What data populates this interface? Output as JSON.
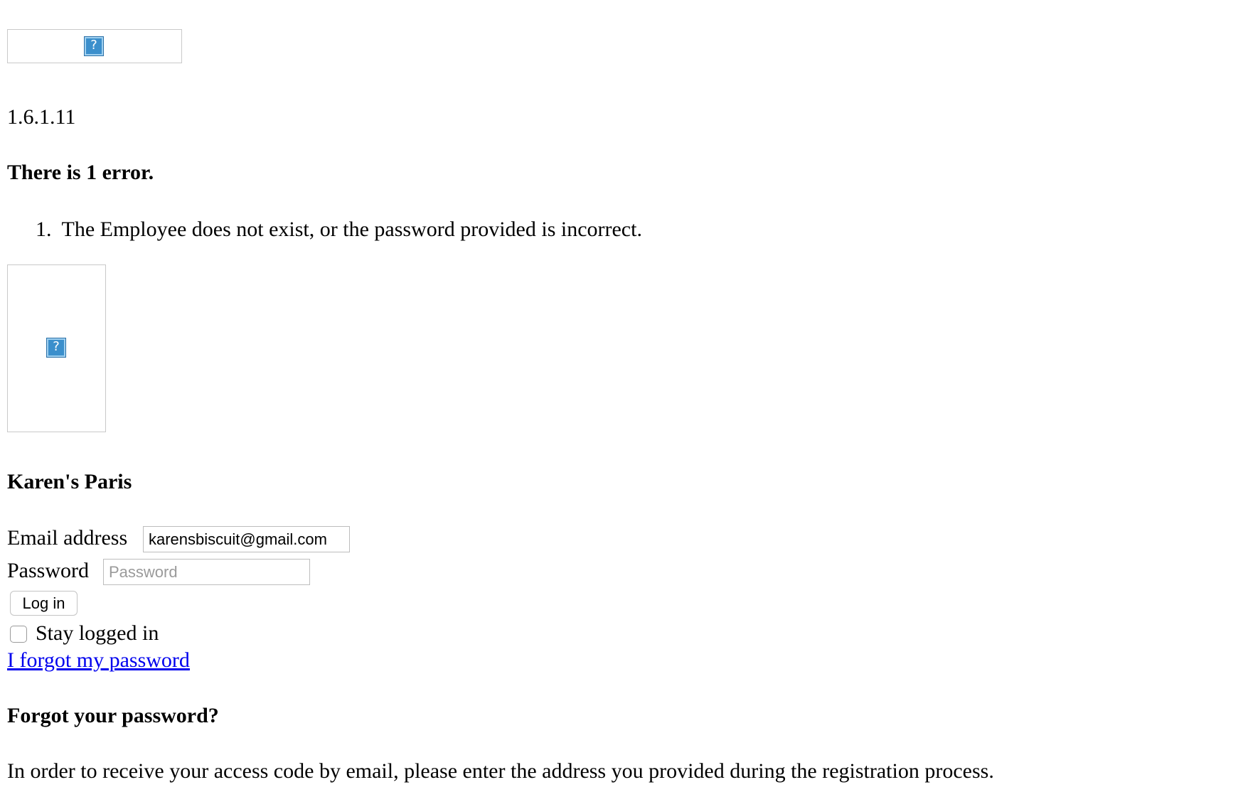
{
  "header": {
    "logo_icon": "broken-image-icon",
    "version": "1.6.1.11"
  },
  "errors": {
    "heading": "There is 1 error.",
    "items": [
      {
        "number": "1.",
        "text": "The Employee does not exist, or the password provided is incorrect."
      }
    ]
  },
  "shop": {
    "image_icon": "broken-image-icon",
    "name": "Karen's Paris"
  },
  "login_form": {
    "email_label": "Email address",
    "email_value": "karensbiscuit@gmail.com",
    "password_label": "Password",
    "password_placeholder": "Password",
    "password_value": "",
    "login_button": "Log in",
    "stay_logged_in_label": "Stay logged in",
    "stay_logged_in_checked": false,
    "forgot_link": "I forgot my password"
  },
  "forgot_password": {
    "heading": "Forgot your password?",
    "instructions": "In order to receive your access code by email, please enter the address you provided during the registration process."
  }
}
